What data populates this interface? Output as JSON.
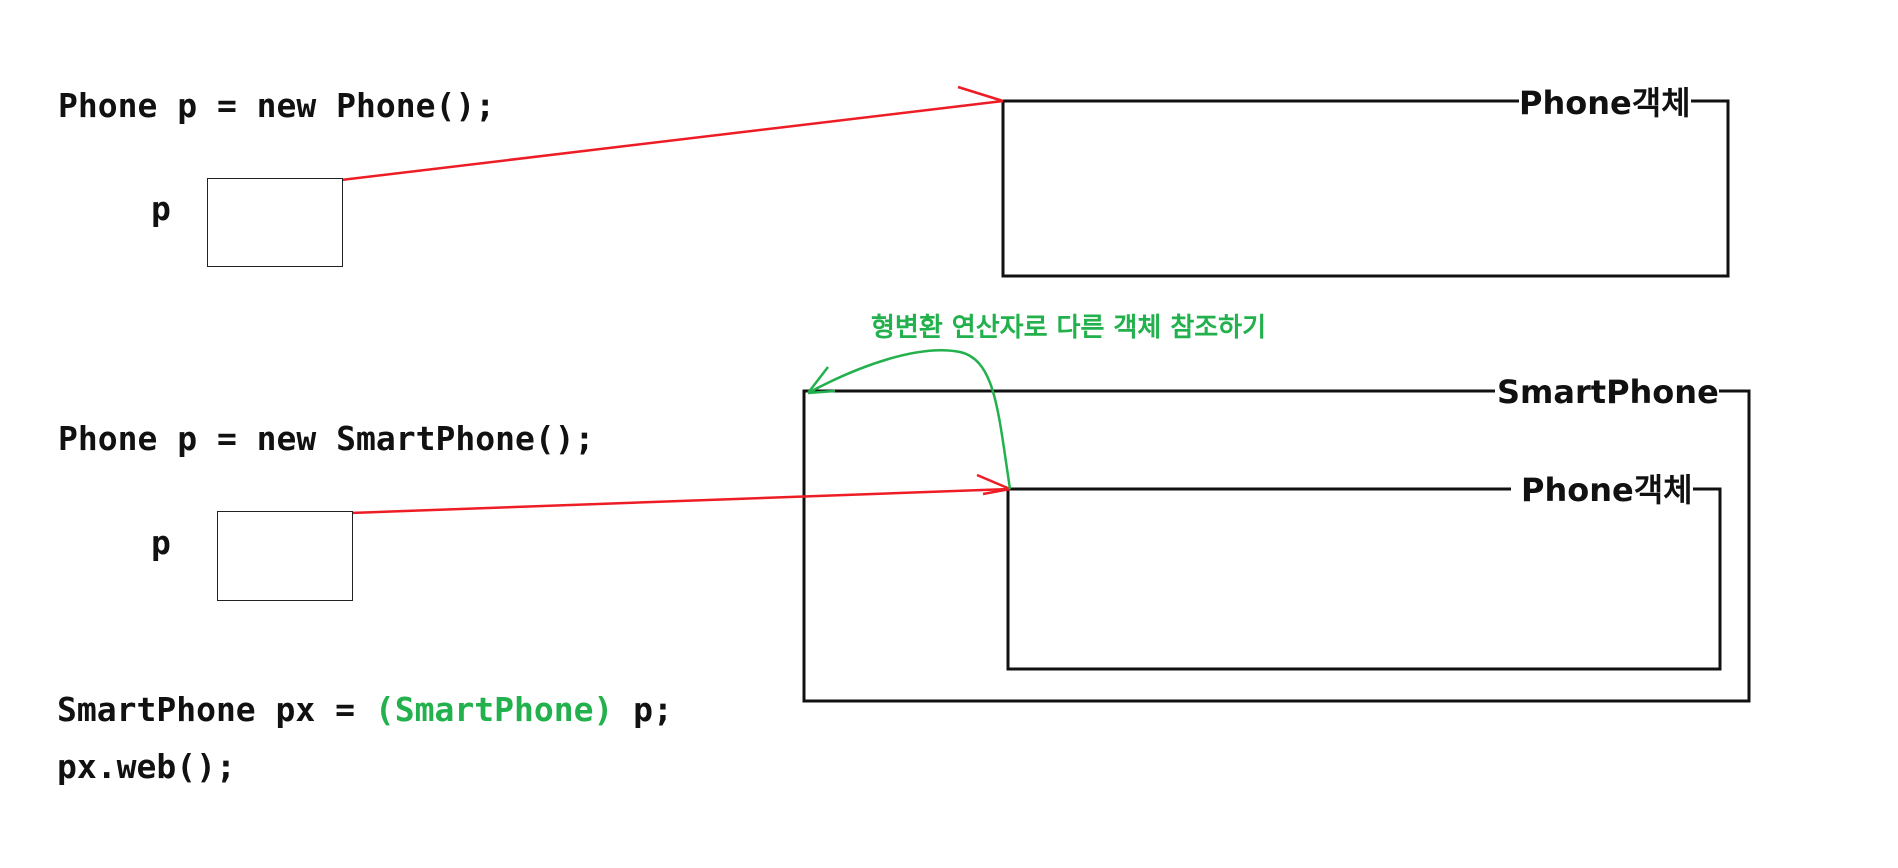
{
  "code": {
    "line1": "Phone p = new Phone();",
    "line2": "Phone p = new SmartPhone();",
    "line3_start": "SmartPhone px = ",
    "line3_cast": "(SmartPhone)",
    "line3_end": " p;",
    "line4": "px.web();"
  },
  "variables": {
    "var1": "p",
    "var2": "p"
  },
  "objects": {
    "phone_object_top": "Phone객체",
    "smartphone_object": "SmartPhone",
    "phone_object_inner": "Phone객체"
  },
  "annotation": {
    "cast_note": "형변환 연산자로 다른 객체 참조하기"
  },
  "colors": {
    "reference_arrow": "#ee1c24",
    "cast_highlight": "#22b14c",
    "outline": "#111111"
  }
}
